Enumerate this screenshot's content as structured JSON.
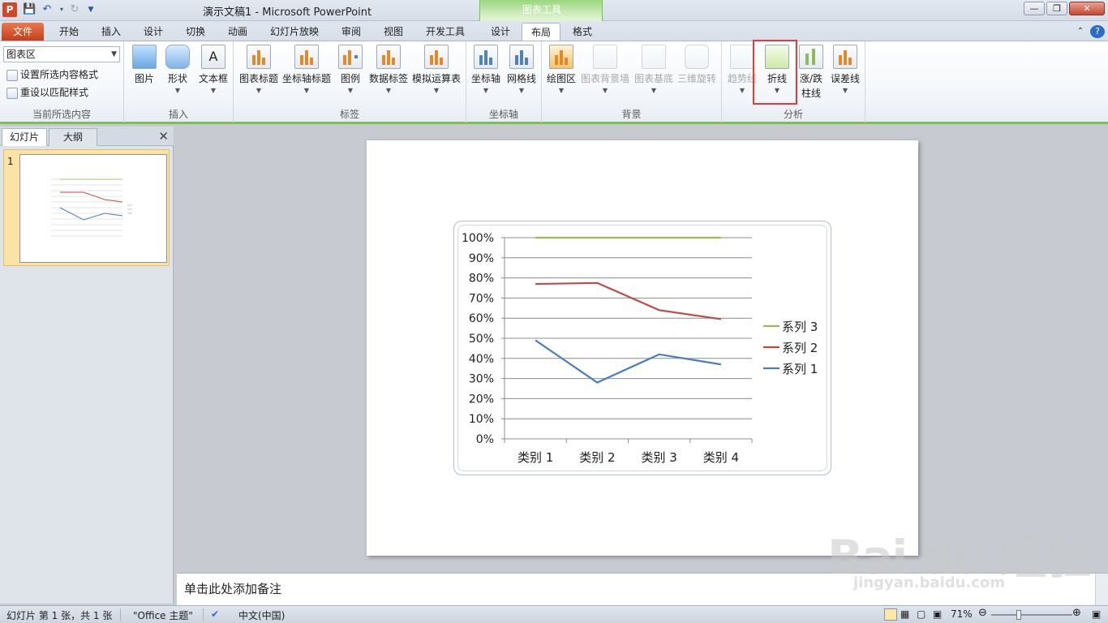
{
  "window": {
    "title": "演示文稿1 - Microsoft PowerPoint",
    "app_icon_letter": "P",
    "context_band": "图表工具"
  },
  "tabs": {
    "file": "文件",
    "items": [
      "开始",
      "插入",
      "设计",
      "切换",
      "动画",
      "幻灯片放映",
      "审阅",
      "视图",
      "开发工具"
    ],
    "ctx_design": "设计",
    "ctx_layout": "布局",
    "ctx_format": "格式"
  },
  "ribbon": {
    "current_selection": {
      "dropdown_value": "图表区",
      "format_selection": "设置所选内容格式",
      "reset_style": "重设以匹配样式",
      "group": "当前所选内容"
    },
    "insert": {
      "picture": "图片",
      "shapes": "形状",
      "textbox": "文本框",
      "group": "插入"
    },
    "labels": {
      "chart_title": "图表标题",
      "axis_titles": "坐标轴标题",
      "legend": "图例",
      "data_labels": "数据标签",
      "data_table": "模拟运算表",
      "group": "标签"
    },
    "axes": {
      "axes": "坐标轴",
      "gridlines": "网格线",
      "group": "坐标轴"
    },
    "background": {
      "plot_area": "绘图区",
      "chart_wall": "图表背景墙",
      "chart_floor": "图表基底",
      "rotation": "三维旋转",
      "group": "背景"
    },
    "analysis": {
      "trendline": "趋势线",
      "lines": "折线",
      "updown_1": "涨/跌",
      "updown_2": "柱线",
      "error_bars": "误差线",
      "group": "分析"
    }
  },
  "slides_pane": {
    "tab_slides": "幻灯片",
    "tab_outline": "大纲",
    "slide_number": "1"
  },
  "notes": {
    "placeholder": "单击此处添加备注"
  },
  "status": {
    "slide_info": "幻灯片 第 1 张，共 1 张",
    "theme": "\"Office 主题\"",
    "language": "中文(中国)",
    "zoom": "71%"
  },
  "watermark": {
    "main": "Bai du 经验",
    "sub": "jingyan.baidu.com"
  },
  "chart_data": {
    "type": "line",
    "title": "",
    "xlabel": "",
    "ylabel": "",
    "categories": [
      "类别 1",
      "类别 2",
      "类别 3",
      "类别 4"
    ],
    "y_ticks": [
      "0%",
      "10%",
      "20%",
      "30%",
      "40%",
      "50%",
      "60%",
      "70%",
      "80%",
      "90%",
      "100%"
    ],
    "ylim": [
      0,
      1
    ],
    "grid": true,
    "legend": "right",
    "series": [
      {
        "name": "系列 1",
        "color": "#4a7ebb",
        "values": [
          0.49,
          0.28,
          0.42,
          0.37
        ]
      },
      {
        "name": "系列 2",
        "color": "#be4b48",
        "values": [
          0.77,
          0.775,
          0.64,
          0.595
        ]
      },
      {
        "name": "系列 3",
        "color": "#98b954",
        "values": [
          1.0,
          1.0,
          1.0,
          1.0
        ]
      }
    ]
  }
}
